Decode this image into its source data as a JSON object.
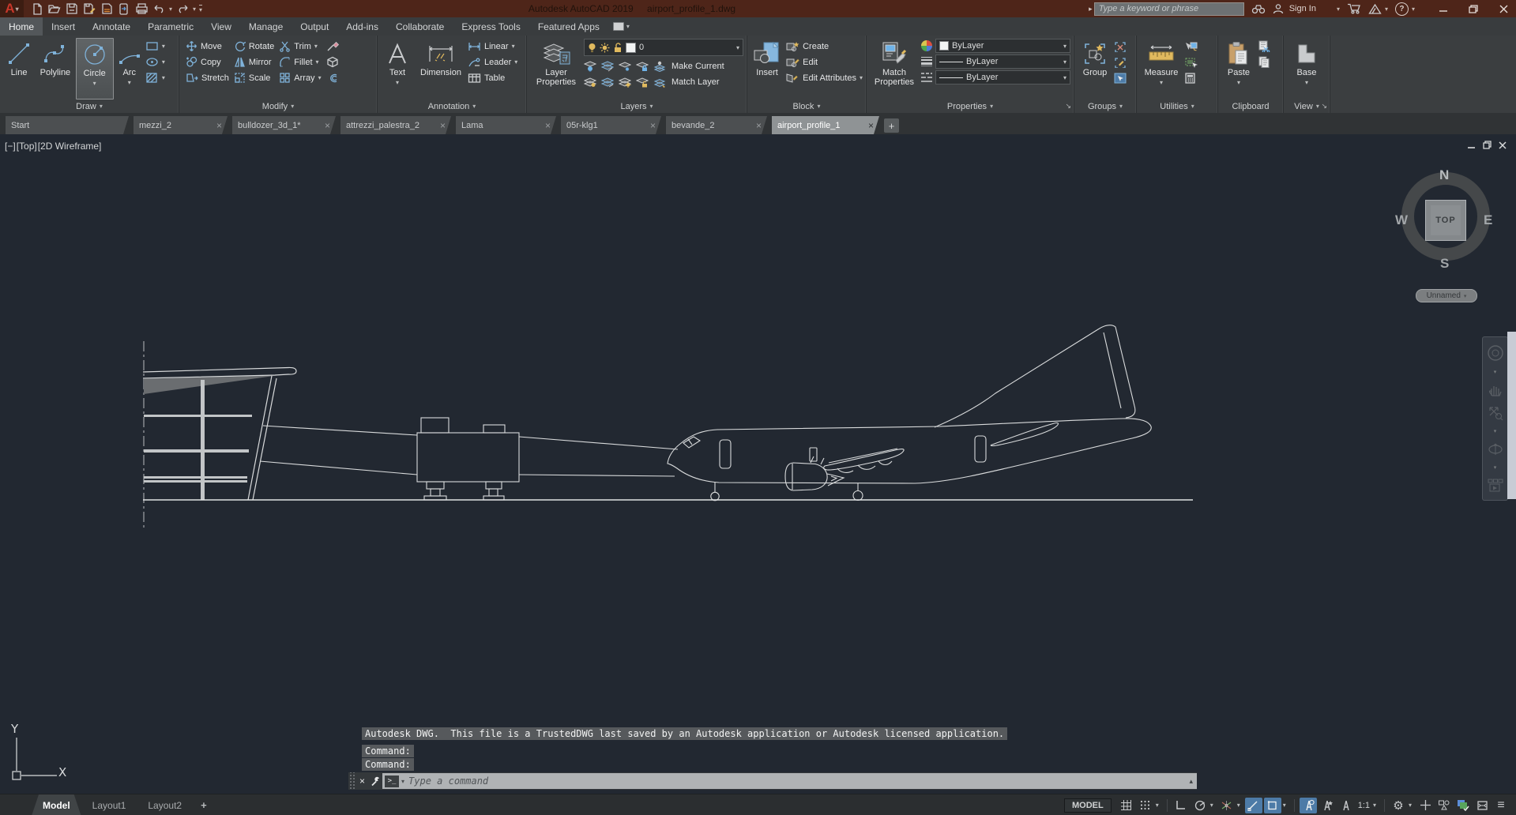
{
  "window": {
    "app_title": "Autodesk AutoCAD 2019",
    "doc_title": "airport_profile_1.dwg"
  },
  "titlebar": {
    "search_placeholder": "Type a keyword or phrase",
    "sign_in_label": "Sign In"
  },
  "ribbon_tabs": [
    "Home",
    "Insert",
    "Annotate",
    "Parametric",
    "View",
    "Manage",
    "Output",
    "Add-ins",
    "Collaborate",
    "Express Tools",
    "Featured Apps"
  ],
  "panels": {
    "draw": {
      "label": "Draw",
      "line": "Line",
      "polyline": "Polyline",
      "circle": "Circle",
      "arc": "Arc"
    },
    "modify": {
      "label": "Modify",
      "move": "Move",
      "rotate": "Rotate",
      "trim": "Trim",
      "copy": "Copy",
      "mirror": "Mirror",
      "fillet": "Fillet",
      "stretch": "Stretch",
      "scale": "Scale",
      "array": "Array"
    },
    "annotation": {
      "label": "Annotation",
      "text": "Text",
      "dimension": "Dimension",
      "linear": "Linear",
      "leader": "Leader",
      "table": "Table"
    },
    "layers": {
      "label": "Layers",
      "layer_properties": "Layer Properties",
      "current_layer": "0",
      "make_current": "Make Current",
      "match_layer": "Match Layer"
    },
    "block": {
      "label": "Block",
      "insert": "Insert",
      "create": "Create",
      "edit": "Edit",
      "edit_attributes": "Edit Attributes"
    },
    "properties": {
      "label": "Properties",
      "match_properties": "Match Properties",
      "color_value": "ByLayer",
      "lineweight_value": "ByLayer",
      "linetype_value": "ByLayer"
    },
    "groups": {
      "label": "Groups",
      "group": "Group"
    },
    "utilities": {
      "label": "Utilities",
      "measure": "Measure"
    },
    "clipboard": {
      "label": "Clipboard",
      "paste": "Paste"
    },
    "view_panel": {
      "label": "View",
      "base": "Base"
    }
  },
  "doc_tabs": [
    "Start",
    "mezzi_2",
    "bulldozer_3d_1*",
    "attrezzi_palestra_2",
    "Lama",
    "05r-klg1",
    "bevande_2",
    "airport_profile_1"
  ],
  "viewport": {
    "minimize": "[−]",
    "view": "[Top]",
    "visual_style": "[2D Wireframe]"
  },
  "viewcube": {
    "north": "N",
    "south": "S",
    "east": "E",
    "west": "W",
    "face": "TOP",
    "preset": "Unnamed"
  },
  "ucs": {
    "x": "X",
    "y": "Y"
  },
  "command": {
    "line1": "Autodesk DWG.  This file is a TrustedDWG last saved by an Autodesk application or Autodesk licensed application.",
    "line2": "Command:",
    "line3": "Command:",
    "input_placeholder": "Type a command"
  },
  "statusbar": {
    "tabs": [
      "Model",
      "Layout1",
      "Layout2"
    ],
    "space_badge": "MODEL",
    "annotation_scale": "1:1"
  },
  "icons": {
    "close": "×",
    "caret_down": "▾",
    "caret_up": "▴",
    "menu": "≡",
    "gear": "⚙",
    "plus": "+",
    "help": "?",
    "prompt": "&gt;_",
    "launcher": "↘",
    "search_go": "▸"
  },
  "colors": {
    "titlebar": "#4e2519",
    "ribbon_icon_blue": "#7fb2d9",
    "canvas_bg": "#222831",
    "drawing_line": "#d9dbdc",
    "status_highlight": "#4d7ba7",
    "accent_yellow": "#e0b95e"
  }
}
